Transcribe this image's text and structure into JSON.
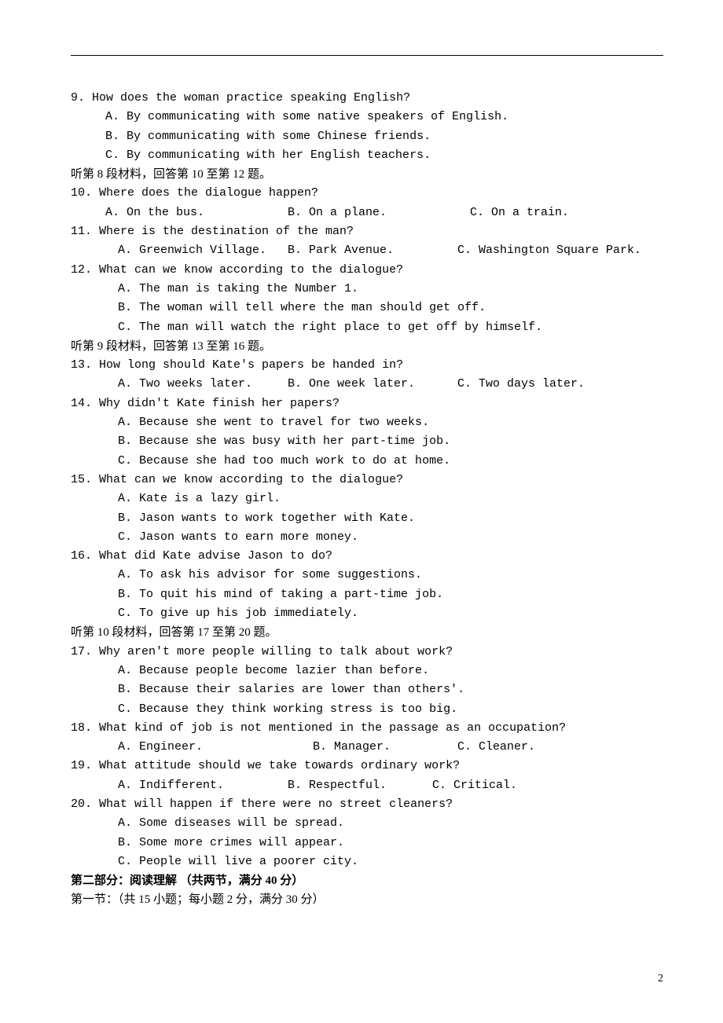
{
  "q9": {
    "text": "9. How does the woman practice speaking English?",
    "A": "A. By communicating with some native speakers of English.",
    "B": "B. By communicating with some Chinese friends.",
    "C": "C. By communicating with her English teachers."
  },
  "seg8": "听第 8 段材料，回答第 10 至第 12 题。",
  "q10": {
    "text": "10. Where does the dialogue happen?",
    "A": "A. On the bus.",
    "B": "B. On a plane.",
    "C": "C. On a train."
  },
  "q11": {
    "text": "11. Where is the destination of the man?",
    "A": "A. Greenwich Village.",
    "B": "B. Park Avenue.",
    "C": "C. Washington Square Park."
  },
  "q12": {
    "text": "12. What can we know according to the dialogue?",
    "A": "A. The man is taking the Number 1.",
    "B": "B. The woman will tell where the man should get off.",
    "C": "C. The man will watch the right place to get off by himself."
  },
  "seg9": "听第 9 段材料，回答第 13 至第 16 题。",
  "q13": {
    "text": "13. How long should Kate's papers be handed in?",
    "A": "A. Two weeks later.",
    "B": "B. One week later.",
    "C": "C. Two days later."
  },
  "q14": {
    "text": "14. Why didn't Kate finish her papers?",
    "A": "A. Because she went to travel for two weeks.",
    "B": "B. Because she was busy with her part-time job.",
    "C": "C. Because she had too much work to do at home."
  },
  "q15": {
    "text": "15. What can we know according to the dialogue?",
    "A": "A. Kate is a lazy girl.",
    "B": "B. Jason wants to work together with Kate.",
    "C": "C. Jason wants to earn more money."
  },
  "q16": {
    "text": "16. What did Kate advise Jason to do?",
    "A": "A. To ask his advisor for some suggestions.",
    "B": "B. To quit his mind of taking a part-time job.",
    "C": "C. To give up his job immediately."
  },
  "seg10": "听第 10 段材料，回答第 17 至第 20 题。",
  "q17": {
    "text": "17. Why aren't more people willing to talk about work?",
    "A": "A. Because people become lazier than before.",
    "B": "B. Because their salaries are lower than others'.",
    "C": "C. Because they think working stress is too big."
  },
  "q18": {
    "text": "18. What kind of job is not mentioned in the passage as an occupation?",
    "A": "A. Engineer.",
    "B": "B. Manager.",
    "C": "C. Cleaner."
  },
  "q19": {
    "text": "19. What attitude should we take towards ordinary work?",
    "A": "A. Indifferent.",
    "B": "B. Respectful.",
    "C": "C. Critical."
  },
  "q20": {
    "text": "20. What will happen if there were no street cleaners?",
    "A": "A. Some diseases will be spread.",
    "B": "B. Some more crimes will appear.",
    "C": "C. People will live a poorer city."
  },
  "part2_header": "第二部分：阅读理解 （共两节，满分 40 分）",
  "part2_sub": "第一节：（共 15 小题；每小题 2 分，满分 30 分）",
  "page_number": "2"
}
